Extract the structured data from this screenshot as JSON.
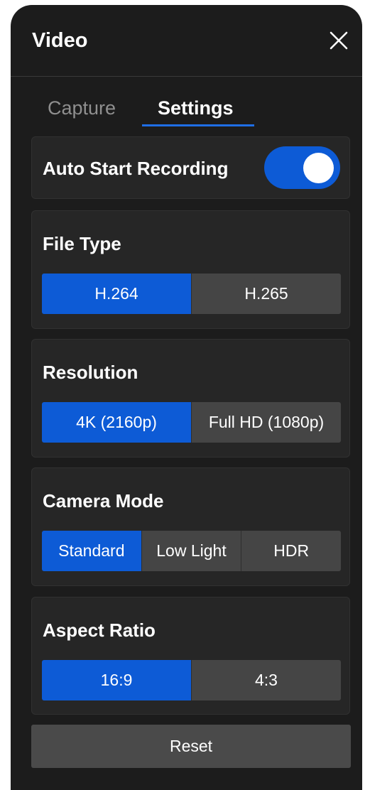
{
  "header": {
    "title": "Video",
    "close_icon": "close-icon"
  },
  "tabs": [
    {
      "label": "Capture",
      "active": false
    },
    {
      "label": "Settings",
      "active": true
    }
  ],
  "settings": {
    "auto_start": {
      "label": "Auto Start Recording",
      "enabled": true
    },
    "file_type": {
      "label": "File Type",
      "options": [
        "H.264",
        "H.265"
      ],
      "selected": "H.264"
    },
    "resolution": {
      "label": "Resolution",
      "options": [
        "4K (2160p)",
        "Full HD (1080p)"
      ],
      "selected": "4K (2160p)"
    },
    "camera_mode": {
      "label": "Camera Mode",
      "options": [
        "Standard",
        "Low Light",
        "HDR"
      ],
      "selected": "Standard"
    },
    "aspect_ratio": {
      "label": "Aspect Ratio",
      "options": [
        "16:9",
        "4:3"
      ],
      "selected": "16:9"
    }
  },
  "reset_label": "Reset",
  "colors": {
    "accent": "#0d5bd6",
    "panel_bg": "#1c1c1c",
    "card_bg": "#262626",
    "segment_bg": "#454545",
    "tab_inactive": "#8f8f8f"
  }
}
